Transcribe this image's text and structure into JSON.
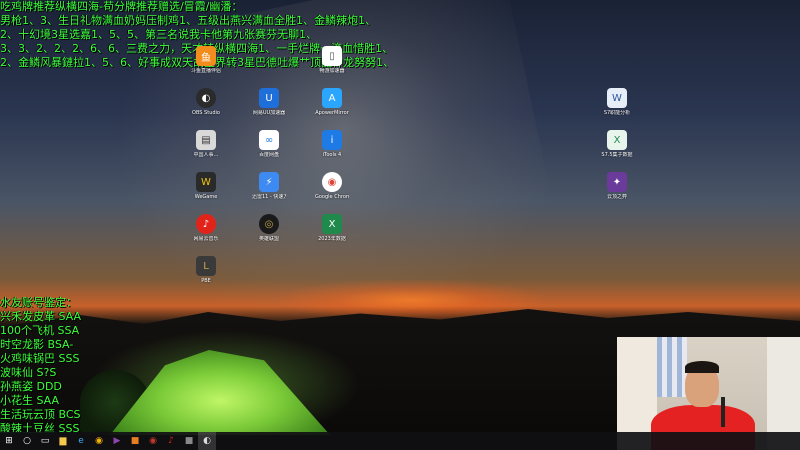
{
  "overlay_top": {
    "lines": [
      "吃鸡牌推荐纵横四海-苟分牌推荐赠选/冒霞/幽潘：",
      "男枪1、3、生日礼物满血奶妈压制鸡1、五级出燕兴满血全胜1、金鳞辣炮1、",
      "2、十幻境3星选嘉1、5、5、第三名说我卡他第九张赛芬无聊1、",
      "3、3、2、2、2、6、6、三费之力，天才转纵横四海1、一手烂牌一滴血惜胜1、",
      "2、金鳞风暴鏈拉1、5、6、好事成双天胡星界转3星巴德吐爆艹顶配神龙努努1、"
    ]
  },
  "overlay_left": {
    "lines": [
      "水友账号鉴定：",
      "兴禾发皮革 SAA",
      "100个飞机 SSA",
      "时空龙影 BSA-",
      "火鸡味锅巴 SSS",
      "波味仙 S?S",
      "孙燕姿 DDD",
      "小花生 SAA",
      "生活玩云顶 BCS",
      "酸辣土豆丝 SSS"
    ]
  },
  "desktop_icons": [
    {
      "label": "斗鱼直播伴侣",
      "icon": "douyu-icon",
      "color": "#f28c1c",
      "glyph": "鱼"
    },
    {
      "label": "畅游加速器",
      "icon": "file-icon",
      "color": "#ffffff",
      "glyph": "▯"
    },
    {
      "label": "OBS Studio",
      "icon": "obs-icon",
      "color": "#2b2b2b",
      "glyph": "◐"
    },
    {
      "label": "网易UU加速器",
      "icon": "uu-icon",
      "color": "#1e6fd9",
      "glyph": "U"
    },
    {
      "label": "ApowerMirror",
      "icon": "apowermirror-icon",
      "color": "#2aa6ff",
      "glyph": "A"
    },
    {
      "label": "中国人事…",
      "icon": "app-icon",
      "color": "#d9d9d9",
      "glyph": "▤"
    },
    {
      "label": "百度网盘",
      "icon": "baidu-netdisk-icon",
      "color": "#ffffff",
      "glyph": "∞"
    },
    {
      "label": "iTools 4",
      "icon": "itools-icon",
      "color": "#1e7be6",
      "glyph": "i"
    },
    {
      "label": "WeGame",
      "icon": "wegame-icon",
      "color": "#2a2a2a",
      "glyph": "W"
    },
    {
      "label": "迅雷11 - 快速方式",
      "icon": "thunder-icon",
      "color": "#3d8bf2",
      "glyph": "⚡"
    },
    {
      "label": "Google Chrome",
      "icon": "chrome-icon",
      "color": "#ffffff",
      "glyph": "◉"
    },
    {
      "label": "网易云音乐",
      "icon": "netease-music-icon",
      "color": "#e2231a",
      "glyph": "♪"
    },
    {
      "label": "英雄联盟",
      "icon": "lol-icon",
      "color": "#1a1a1a",
      "glyph": "◎"
    },
    {
      "label": "2023年数据",
      "icon": "excel-icon",
      "color": "#1f8a4c",
      "glyph": "X"
    },
    {
      "label": "PBE",
      "icon": "pbe-icon",
      "color": "#3a3a3a",
      "glyph": "L"
    },
    {
      "label": "S7职能分析",
      "icon": "word-icon",
      "color": "#e8eef8",
      "glyph": "W"
    },
    {
      "label": "S7.5集子数据",
      "icon": "excel-file-icon",
      "color": "#e8f5ec",
      "glyph": "X"
    },
    {
      "label": "云顶之弈",
      "icon": "tft-icon",
      "color": "#6a3b9a",
      "glyph": "✦"
    }
  ],
  "taskbar": {
    "items": [
      {
        "name": "start-icon",
        "glyph": "⊞",
        "color": "#ffffff"
      },
      {
        "name": "search-icon",
        "glyph": "○",
        "color": "#ffffff"
      },
      {
        "name": "task-view-icon",
        "glyph": "▭",
        "color": "#ffffff"
      },
      {
        "name": "file-explorer-icon",
        "glyph": "▆",
        "color": "#f2c94c"
      },
      {
        "name": "edge-icon",
        "glyph": "e",
        "color": "#3fa9f5"
      },
      {
        "name": "chrome-taskbar-icon",
        "glyph": "◉",
        "color": "#f4b400"
      },
      {
        "name": "media-player-icon",
        "glyph": "▶",
        "color": "#8e44ad"
      },
      {
        "name": "app-icon",
        "glyph": "■",
        "color": "#e67e22"
      },
      {
        "name": "game-icon",
        "glyph": "◉",
        "color": "#c0392b"
      },
      {
        "name": "netease-music-taskbar-icon",
        "glyph": "♪",
        "color": "#e2231a"
      },
      {
        "name": "app2-icon",
        "glyph": "■",
        "color": "#888888"
      },
      {
        "name": "obs-taskbar-icon",
        "glyph": "◐",
        "color": "#dddddd"
      }
    ]
  }
}
